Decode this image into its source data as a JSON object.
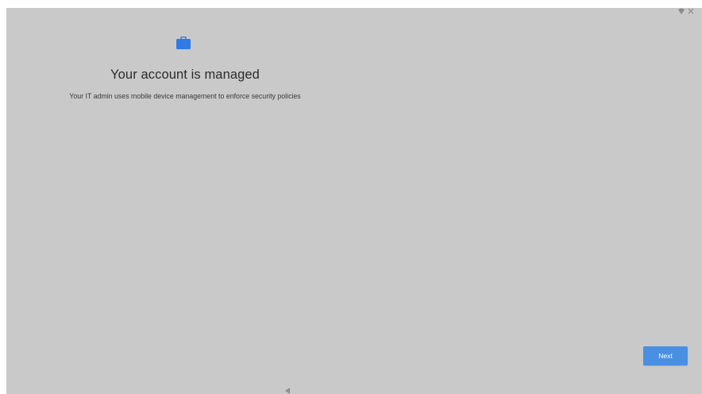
{
  "status_bar": {
    "icons": [
      "wifi-icon",
      "close-icon"
    ]
  },
  "main": {
    "icon": "briefcase-icon",
    "title": "Your account is managed",
    "subtitle": "Your IT admin uses mobile device management to enforce security policies"
  },
  "footer": {
    "next_label": "Next"
  },
  "navigation": {
    "back_icon": "back-triangle-icon"
  },
  "colors": {
    "background": "#c9c9c9",
    "accent": "#4a90e2",
    "icon_blue": "#2f7be6",
    "text": "#2b2b2b"
  }
}
